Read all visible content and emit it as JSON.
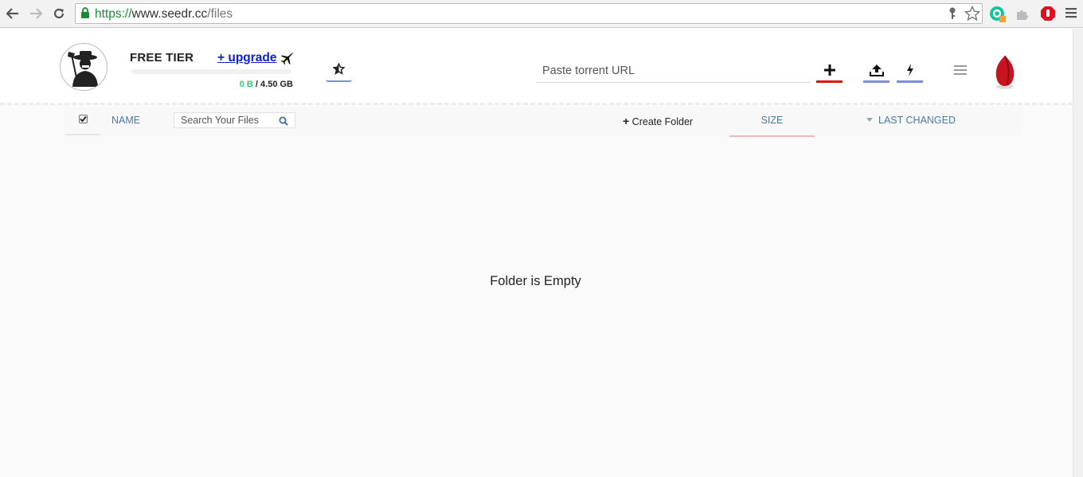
{
  "browser": {
    "url_scheme": "https://",
    "url_host": "www.seedr.cc",
    "url_path": "/files"
  },
  "header": {
    "tier_label": "FREE TIER",
    "upgrade_label": "+ upgrade",
    "quota_used": "0 B",
    "quota_separator": " / ",
    "quota_total": "4.50 GB",
    "quota_fraction": 0,
    "torrent_placeholder": "Paste torrent URL"
  },
  "toolbar": {
    "name_label": "NAME",
    "search_placeholder": "Search Your Files",
    "create_folder_label": "Create Folder",
    "size_label": "SIZE",
    "last_changed_label": "LAST CHANGED"
  },
  "content": {
    "empty_message": "Folder is Empty"
  },
  "colors": {
    "accent_blue": "#7b8fd6",
    "add_red": "#e01010",
    "quota_green": "#2ecc71",
    "link_blue": "#0b22cc"
  }
}
